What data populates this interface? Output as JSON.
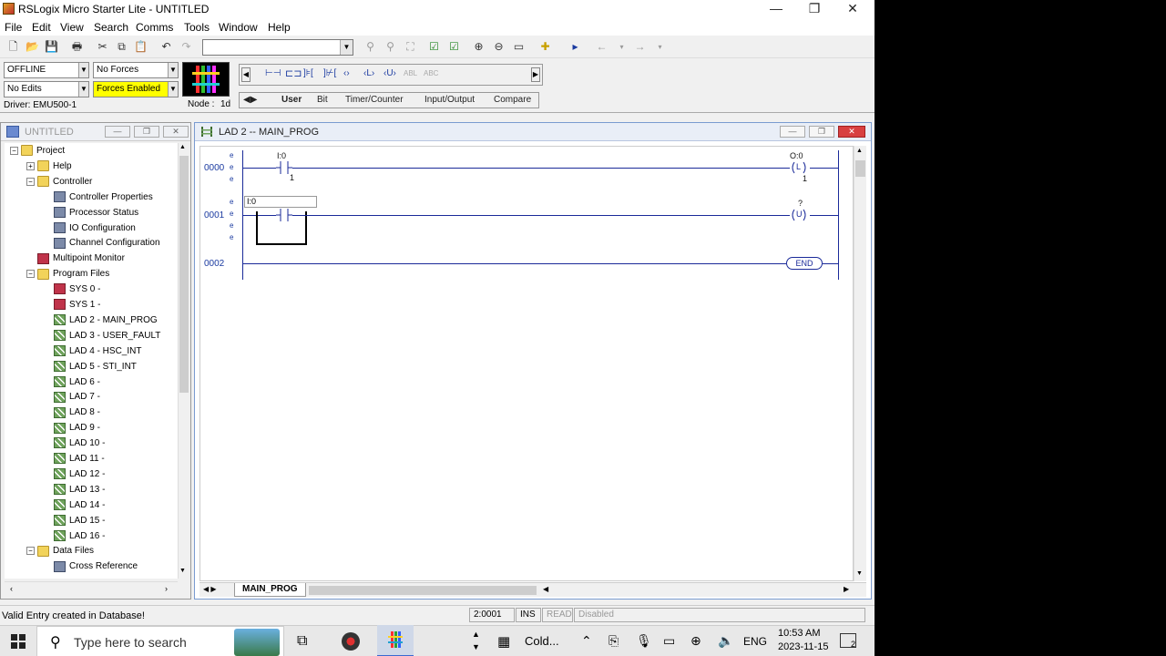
{
  "window": {
    "title": "RSLogix Micro Starter Lite - UNTITLED",
    "minimize": "—",
    "maximize": "❐",
    "close": "✕"
  },
  "menu": [
    "File",
    "Edit",
    "View",
    "Search",
    "Comms",
    "Tools",
    "Window",
    "Help"
  ],
  "status": {
    "mode": "OFFLINE",
    "forces": "No Forces",
    "edits": "No Edits",
    "forces_enabled": "Forces Enabled",
    "node_label": "Node :",
    "node_value": "1d",
    "driver": "Driver: EMU500-1",
    "forces_enabled_color": "#ffff00"
  },
  "instruction_tabs": [
    "User",
    "Bit",
    "Timer/Counter",
    "Input/Output",
    "Compare"
  ],
  "project_panel": {
    "title": "UNTITLED",
    "tree": [
      {
        "label": "Project",
        "level": 0,
        "icon": "folder",
        "exp": "−"
      },
      {
        "label": "Help",
        "level": 1,
        "icon": "folder",
        "exp": "+"
      },
      {
        "label": "Controller",
        "level": 1,
        "icon": "folder",
        "exp": "−"
      },
      {
        "label": "Controller Properties",
        "level": 2,
        "icon": "gen"
      },
      {
        "label": "Processor Status",
        "level": 2,
        "icon": "gen"
      },
      {
        "label": "IO Configuration",
        "level": 2,
        "icon": "gen"
      },
      {
        "label": "Channel Configuration",
        "level": 2,
        "icon": "gen"
      },
      {
        "label": "Multipoint Monitor",
        "level": 1,
        "icon": "sys"
      },
      {
        "label": "Program Files",
        "level": 1,
        "icon": "folder",
        "exp": "−"
      },
      {
        "label": "SYS 0 -",
        "level": 2,
        "icon": "sys"
      },
      {
        "label": "SYS 1 -",
        "level": 2,
        "icon": "sys"
      },
      {
        "label": "LAD 2 - MAIN_PROG",
        "level": 2,
        "icon": "lad"
      },
      {
        "label": "LAD 3 - USER_FAULT",
        "level": 2,
        "icon": "lad"
      },
      {
        "label": "LAD 4 - HSC_INT",
        "level": 2,
        "icon": "lad"
      },
      {
        "label": "LAD 5 - STI_INT",
        "level": 2,
        "icon": "lad"
      },
      {
        "label": "LAD 6 -",
        "level": 2,
        "icon": "lad"
      },
      {
        "label": "LAD 7 -",
        "level": 2,
        "icon": "lad"
      },
      {
        "label": "LAD 8 -",
        "level": 2,
        "icon": "lad"
      },
      {
        "label": "LAD 9 -",
        "level": 2,
        "icon": "lad"
      },
      {
        "label": "LAD 10 -",
        "level": 2,
        "icon": "lad"
      },
      {
        "label": "LAD 11 -",
        "level": 2,
        "icon": "lad"
      },
      {
        "label": "LAD 12 -",
        "level": 2,
        "icon": "lad"
      },
      {
        "label": "LAD 13 -",
        "level": 2,
        "icon": "lad"
      },
      {
        "label": "LAD 14 -",
        "level": 2,
        "icon": "lad"
      },
      {
        "label": "LAD 15 -",
        "level": 2,
        "icon": "lad"
      },
      {
        "label": "LAD 16 -",
        "level": 2,
        "icon": "lad"
      },
      {
        "label": "Data Files",
        "level": 1,
        "icon": "folder",
        "exp": "−"
      },
      {
        "label": "Cross Reference",
        "level": 2,
        "icon": "gen"
      }
    ]
  },
  "ladder_window": {
    "title": "LAD 2 -- MAIN_PROG",
    "tab": "MAIN_PROG",
    "rungs": [
      {
        "num": "0000",
        "input_addr": "I:0",
        "input_bit": "1",
        "output_addr": "O:0",
        "output_bit": "1",
        "output_sym": "L"
      },
      {
        "num": "0001",
        "input_addr": "I:0",
        "output_addr": "?",
        "output_sym": "U"
      },
      {
        "num": "0002",
        "end_label": "END"
      }
    ],
    "rail_markers": [
      "e",
      "e",
      "e",
      "e",
      "e",
      "e",
      "e"
    ]
  },
  "statusbar": {
    "message": "Valid Entry created in Database!",
    "position": "2:0001",
    "ins": "INS",
    "read": "READ",
    "disabled": "Disabled"
  },
  "taskbar": {
    "search_placeholder": "Type here to search",
    "weather": "Cold...",
    "language": "ENG",
    "time": "10:53 AM",
    "date": "2023-11-15",
    "notifications": "2"
  }
}
